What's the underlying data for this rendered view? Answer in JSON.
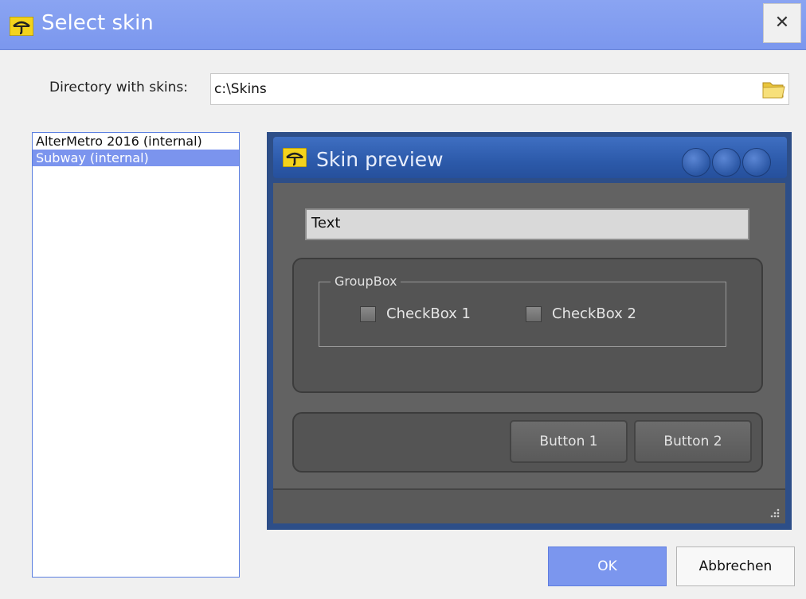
{
  "window": {
    "title": "Select skin",
    "close_glyph": "✕",
    "app_icon": "umbrella-icon",
    "accent_color": "#7b97ee"
  },
  "directory": {
    "label": "Directory with skins:",
    "value": "c:\\Skins",
    "browse_icon": "folder-icon"
  },
  "skins": {
    "items": [
      {
        "label": "AlterMetro 2016 (internal)"
      },
      {
        "label": "Subway (internal)"
      }
    ],
    "selected_index": 1
  },
  "preview": {
    "title": "Skin preview",
    "text_field_value": "Text",
    "groupbox_label": "GroupBox",
    "checkbox1_label": "CheckBox 1",
    "checkbox2_label": "CheckBox 2",
    "button1_label": "Button 1",
    "button2_label": "Button 2",
    "title_color": "#2c5aaa",
    "client_color": "#626262"
  },
  "buttons": {
    "ok_label": "OK",
    "cancel_label": "Abbrechen"
  }
}
